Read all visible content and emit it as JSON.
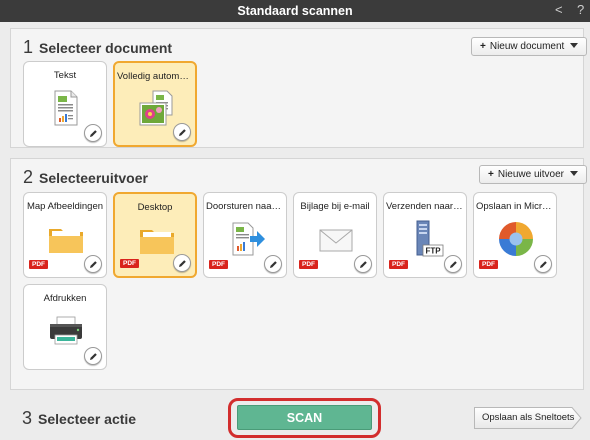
{
  "window": {
    "title": "Standaard scannen",
    "back_glyph": "<",
    "help_glyph": "?"
  },
  "section1": {
    "number": "1",
    "heading": "Selecteer document",
    "new_button": {
      "plus": "+",
      "label": "Nieuw document"
    },
    "tiles": [
      {
        "label": "Tekst",
        "icon": "text-document-icon",
        "selected": false
      },
      {
        "label": "Volledig automatis...",
        "icon": "photo-document-icon",
        "selected": true
      }
    ]
  },
  "section2": {
    "number": "2",
    "heading": "Selecteeruitvoer",
    "new_button": {
      "plus": "+",
      "label": "Nieuwe uitvoer"
    },
    "pdf_badge": "PDF",
    "tiles": [
      {
        "label": "Map Afbeeldingen",
        "icon": "folder-icon",
        "selected": false,
        "pdf": true
      },
      {
        "label": "Desktop",
        "icon": "folder-icon",
        "selected": true,
        "pdf": true
      },
      {
        "label": "Doorsturen naar t...",
        "icon": "forward-document-icon",
        "selected": false,
        "pdf": true
      },
      {
        "label": "Bijlage bij e-mail",
        "icon": "envelope-icon",
        "selected": false,
        "pdf": true
      },
      {
        "label": "Verzenden naar FT...",
        "icon": "ftp-server-icon",
        "selected": false,
        "pdf": true
      },
      {
        "label": "Opslaan in Micros...",
        "icon": "microsoft-app-icon",
        "selected": false,
        "pdf": true
      },
      {
        "label": "Afdrukken",
        "icon": "printer-icon",
        "selected": false,
        "pdf": false
      }
    ]
  },
  "section3": {
    "number": "3",
    "heading": "Selecteer actie",
    "scan_label": "SCAN",
    "shortcut_label": "Opslaan als Sneltoets"
  },
  "colors": {
    "titlebar": "#3b3b3b",
    "scan_button": "#5fb692",
    "highlight_ring": "#d22d2d",
    "selected_tile_bg": "#fdedb9",
    "selected_tile_border": "#f0a830",
    "pdf_badge": "#d9241c"
  }
}
